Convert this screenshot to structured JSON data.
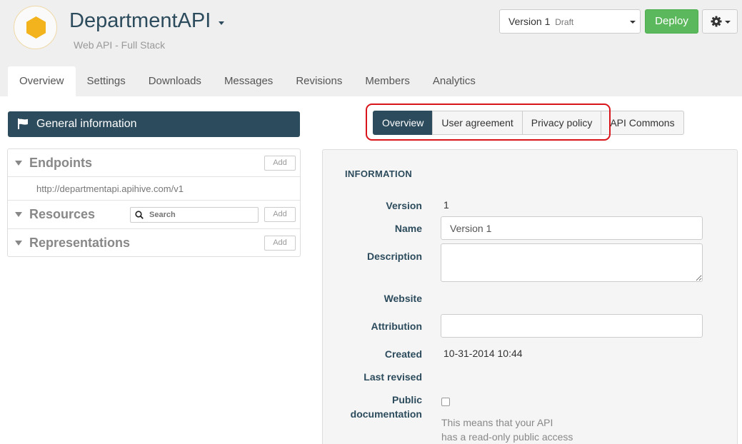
{
  "header": {
    "title": "DepartmentAPI",
    "subtitle": "Web API - Full Stack",
    "logo_color": "#f3b31c",
    "version": {
      "label": "Version 1",
      "status": "Draft"
    },
    "deploy_label": "Deploy",
    "settings_icon": "gear-icon"
  },
  "main_tabs": [
    "Overview",
    "Settings",
    "Downloads",
    "Messages",
    "Revisions",
    "Members",
    "Analytics"
  ],
  "active_main_tab": "Overview",
  "left": {
    "general_info_label": "General information",
    "sections": {
      "endpoints": {
        "title": "Endpoints",
        "add_label": "Add",
        "items": [
          "http://departmentapi.apihive.com/v1"
        ]
      },
      "resources": {
        "title": "Resources",
        "add_label": "Add",
        "search_placeholder": "Search"
      },
      "representations": {
        "title": "Representations",
        "add_label": "Add"
      }
    }
  },
  "sub_tabs": [
    "Overview",
    "User agreement",
    "Privacy policy",
    "API Commons"
  ],
  "active_sub_tab": "Overview",
  "info": {
    "heading": "INFORMATION",
    "version_label": "Version",
    "version_value": "1",
    "name_label": "Name",
    "name_value": "Version 1",
    "description_label": "Description",
    "description_value": "",
    "website_label": "Website",
    "attribution_label": "Attribution",
    "attribution_value": "",
    "created_label": "Created",
    "created_value": "10-31-2014 10:44",
    "last_revised_label": "Last revised",
    "public_doc_label_1": "Public",
    "public_doc_label_2": "documentation",
    "public_doc_checked": false,
    "public_doc_help_1": "This means that your API",
    "public_doc_help_2": "has a read-only public access"
  },
  "colors": {
    "primary": "#2c4b5c",
    "deploy": "#5cb85c",
    "highlight": "#d9141b"
  }
}
